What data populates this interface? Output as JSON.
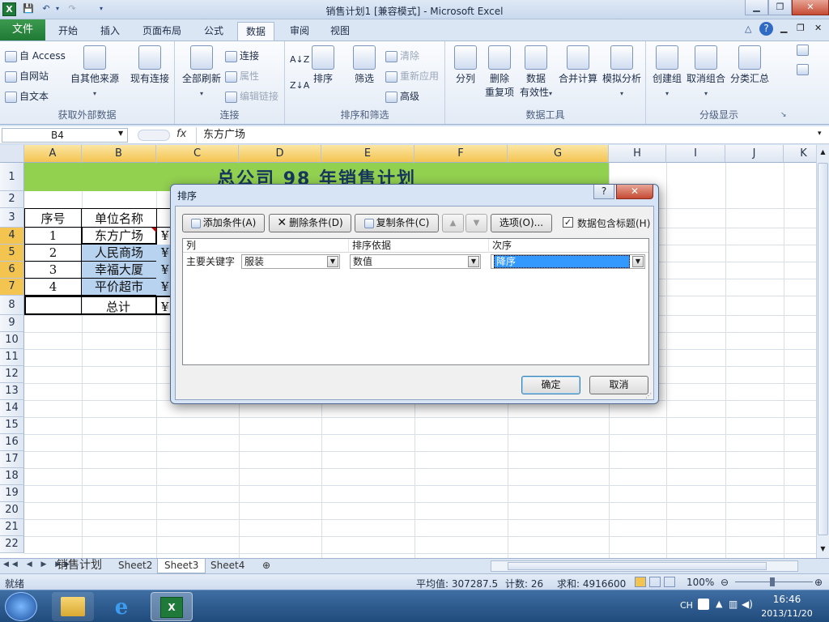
{
  "window": {
    "title": "销售计划1  [兼容模式] - Microsoft Excel",
    "app_icon": "X"
  },
  "quick_access": {
    "save_icon": "save-icon",
    "undo_icon": "undo-icon",
    "redo_icon": "redo-icon"
  },
  "window_controls": {
    "minimize": "▁",
    "restore": "❐",
    "close": "✕"
  },
  "tabs": [
    {
      "label": "文件"
    },
    {
      "label": "开始"
    },
    {
      "label": "插入"
    },
    {
      "label": "页面布局"
    },
    {
      "label": "公式"
    },
    {
      "label": "数据"
    },
    {
      "label": "审阅"
    },
    {
      "label": "视图"
    }
  ],
  "ribbon": {
    "groups": {
      "external": {
        "label": "获取外部数据",
        "access": "自 Access",
        "web": "自网站",
        "text": "自文本",
        "other": "自其他来源",
        "existing": "现有连接"
      },
      "connections": {
        "label": "连接",
        "refresh_all": "全部刷新",
        "connections": "连接",
        "properties": "属性",
        "edit_links": "编辑链接"
      },
      "sort_filter": {
        "label": "排序和筛选",
        "sort": "排序",
        "filter": "筛选",
        "clear": "清除",
        "reapply": "重新应用",
        "advanced": "高级"
      },
      "data_tools": {
        "label": "数据工具",
        "text_to_columns": "分列",
        "remove_dup_1": "删除",
        "remove_dup_2": "重复项",
        "validation_1": "数据",
        "validation_2": "有效性",
        "consolidate": "合并计算",
        "whatif": "模拟分析"
      },
      "outline": {
        "label": "分级显示",
        "group": "创建组",
        "ungroup": "取消组合",
        "subtotal": "分类汇总"
      }
    }
  },
  "formula_bar": {
    "name_box": "B4",
    "fx": "fx",
    "content": "东方广场"
  },
  "columns": [
    "A",
    "B",
    "C",
    "D",
    "E",
    "F",
    "G",
    "H",
    "I",
    "J",
    "K"
  ],
  "rows": [
    "1",
    "2",
    "3",
    "4",
    "5",
    "6",
    "7",
    "8",
    "9",
    "10",
    "11",
    "12",
    "13",
    "14",
    "15",
    "16",
    "17",
    "18",
    "19",
    "20",
    "21",
    "22"
  ],
  "sheet": {
    "title": "总公司 98 年销售计划",
    "header": {
      "num": "序号",
      "name": "单位名称"
    },
    "body": [
      {
        "num": "1",
        "name": "东方广场",
        "c": "¥"
      },
      {
        "num": "2",
        "name": "人民商场",
        "c": "¥"
      },
      {
        "num": "3",
        "name": "幸福大厦",
        "c": "¥"
      },
      {
        "num": "4",
        "name": "平价超市",
        "c": "¥"
      }
    ],
    "total": {
      "label": "总计",
      "c": "¥"
    }
  },
  "sheet_tabs": [
    "销售计划",
    "Sheet2",
    "Sheet3",
    "Sheet4"
  ],
  "status": {
    "ready": "就绪",
    "average": "平均值: 307287.5",
    "count": "计数: 26",
    "sum": "求和: 4916600",
    "zoom": "100%"
  },
  "taskbar": {
    "lang": "CH",
    "time": "16:46",
    "date": "2013/11/20"
  },
  "dialog": {
    "title": "排序",
    "help": "?",
    "close": "✕",
    "add_level": "添加条件(A)",
    "delete_level": "删除条件(D)",
    "copy_level": "复制条件(C)",
    "up": "▲",
    "down": "▼",
    "options": "选项(O)...",
    "header_checkbox_label": "数据包含标题(H)",
    "header_checked": true,
    "col_header": "列",
    "sorton_header": "排序依据",
    "order_header": "次序",
    "row_label": "主要关键字",
    "column_value": "服装",
    "sorton_value": "数值",
    "order_value": "降序",
    "ok": "确定",
    "cancel": "取消"
  }
}
